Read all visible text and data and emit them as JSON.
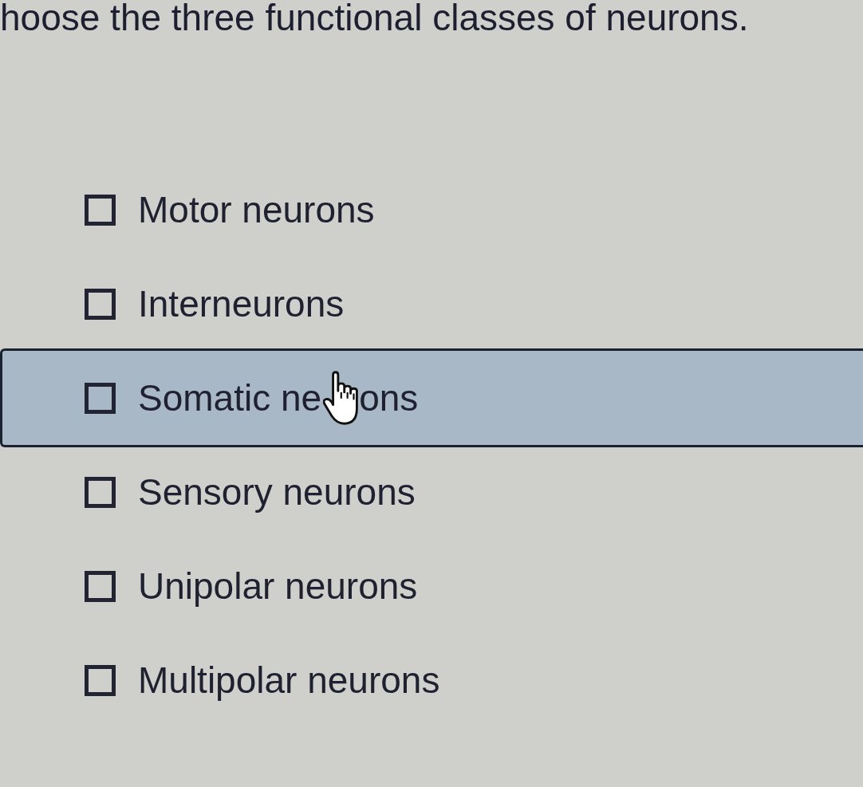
{
  "question": {
    "text": "hoose the three functional classes of neurons."
  },
  "options": [
    {
      "label": "Motor neurons",
      "checked": false,
      "hovered": false
    },
    {
      "label": "Interneurons",
      "checked": false,
      "hovered": false
    },
    {
      "label": "Somatic ne",
      "label_after_cursor": "ons",
      "checked": false,
      "hovered": true
    },
    {
      "label": "Sensory neurons",
      "checked": false,
      "hovered": false
    },
    {
      "label": "Unipolar neurons",
      "checked": false,
      "hovered": false
    },
    {
      "label": "Multipolar neurons",
      "checked": false,
      "hovered": false
    }
  ]
}
